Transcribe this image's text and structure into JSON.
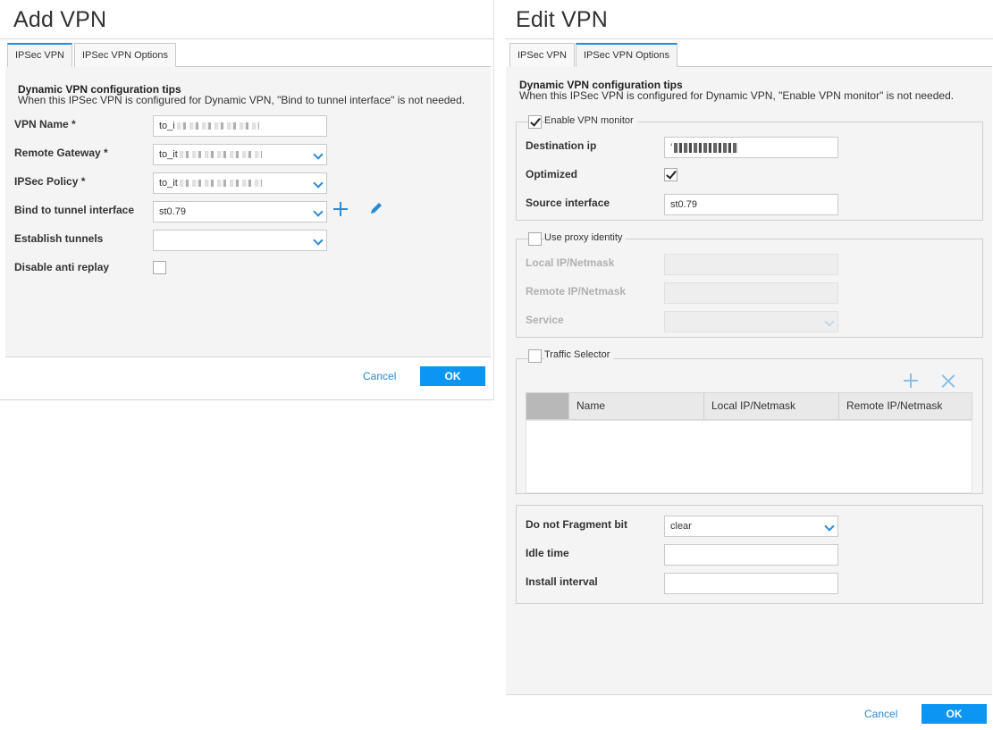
{
  "add_vpn": {
    "title": "Add VPN",
    "tabs": [
      {
        "label": "IPSec VPN",
        "active": true
      },
      {
        "label": "IPSec VPN Options",
        "active": false
      }
    ],
    "tips_title": "Dynamic VPN configuration tips",
    "tips_text": "When this IPSec VPN is configured for Dynamic VPN, \"Bind to tunnel interface\" is not needed.",
    "fields": {
      "vpn_name": {
        "label": "VPN Name *",
        "value": "to_i"
      },
      "remote_gateway": {
        "label": "Remote Gateway *",
        "value": "to_it"
      },
      "ipsec_policy": {
        "label": "IPSec Policy *",
        "value": "to_it"
      },
      "bind_tunnel": {
        "label": "Bind to tunnel interface",
        "value": "st0.79"
      },
      "establish_tunnels": {
        "label": "Establish tunnels",
        "value": ""
      },
      "disable_anti_replay": {
        "label": "Disable anti replay",
        "checked": false
      }
    },
    "cancel_label": "Cancel",
    "ok_label": "OK"
  },
  "edit_vpn": {
    "title": "Edit VPN",
    "tabs": [
      {
        "label": "IPSec VPN",
        "active": false
      },
      {
        "label": "IPSec VPN Options",
        "active": true
      }
    ],
    "tips_title": "Dynamic VPN configuration tips",
    "tips_text": "When this IPSec VPN is configured for Dynamic VPN, \"Enable VPN monitor\" is not needed.",
    "vpn_monitor": {
      "legend": "Enable VPN monitor",
      "enabled": true,
      "destination_ip": {
        "label": "Destination ip",
        "value": "‘"
      },
      "optimized": {
        "label": "Optimized",
        "checked": true
      },
      "source_interface": {
        "label": "Source interface",
        "value": "st0.79"
      }
    },
    "proxy_identity": {
      "legend": "Use proxy identity",
      "enabled": false,
      "local_ip": {
        "label": "Local IP/Netmask"
      },
      "remote_ip": {
        "label": "Remote IP/Netmask"
      },
      "service": {
        "label": "Service"
      }
    },
    "traffic_selector": {
      "legend": "Traffic Selector",
      "enabled": false,
      "columns": [
        "Name",
        "Local IP/Netmask",
        "Remote IP/Netmask"
      ],
      "rows": []
    },
    "misc": {
      "do_not_fragment": {
        "label": "Do not Fragment bit",
        "value": "clear"
      },
      "idle_time": {
        "label": "Idle time",
        "value": ""
      },
      "install_interval": {
        "label": "Install interval",
        "value": ""
      }
    },
    "cancel_label": "Cancel",
    "ok_label": "OK"
  },
  "colors": {
    "accent": "#2a8ad4",
    "ok_button": "#0a96f2",
    "panel_bg": "#f4f4f4"
  }
}
